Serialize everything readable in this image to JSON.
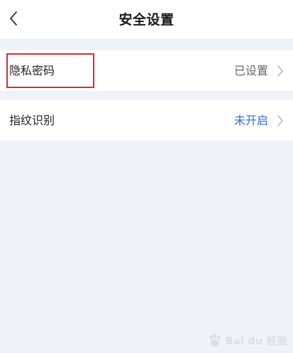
{
  "header": {
    "title": "安全设置",
    "back_icon": "chevron-left-icon"
  },
  "settings": [
    {
      "label": "隐私密码",
      "value": "已设置",
      "value_color": "#666666",
      "chevron_icon": "chevron-right-icon"
    },
    {
      "label": "指纹识别",
      "value": "未开启",
      "value_color": "#2f6fd6",
      "chevron_icon": "chevron-right-icon"
    }
  ],
  "annotation": {
    "color": "#d32f2f"
  },
  "watermark": {
    "text": "Bai du 经验",
    "icon": "baidu-paw-icon"
  }
}
